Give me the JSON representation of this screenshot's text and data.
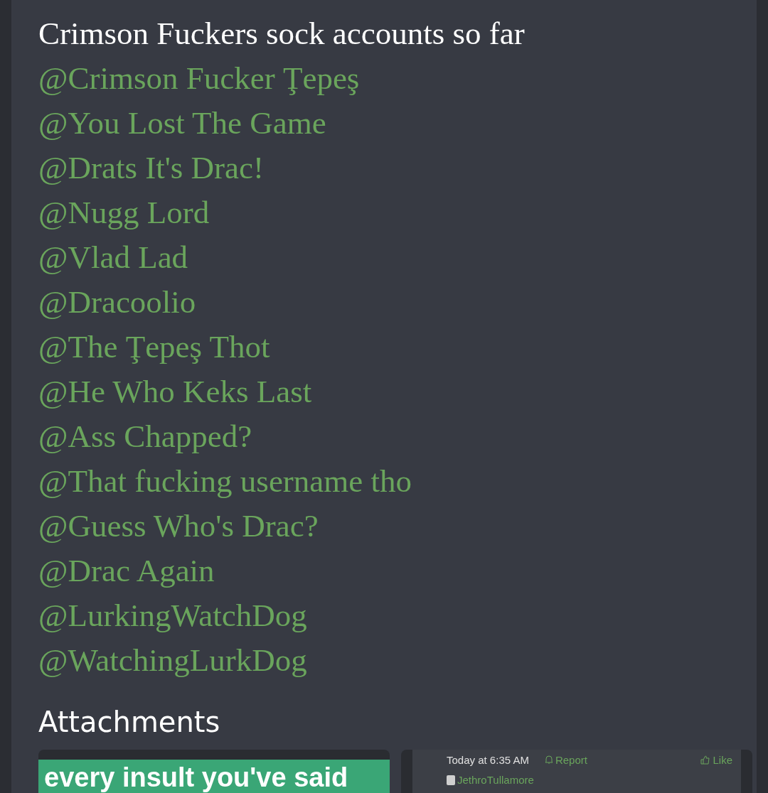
{
  "post": {
    "intro": "Crimson Fuckers sock accounts so far",
    "mentions": [
      "@Crimson Fucker Ţepeş",
      "@You Lost The Game",
      "@Drats It's Drac!",
      "@Nugg Lord",
      "@Vlad Lad",
      "@Dracoolio",
      "@The Ţepeş Thot",
      "@He Who Keks Last",
      "@Ass Chapped?",
      "@That fucking username tho",
      "@Guess Who's Drac?",
      "@Drac Again",
      "@LurkingWatchDog",
      "@WatchingLurkDog"
    ]
  },
  "attachments": {
    "title": "Attachments",
    "items": [
      {
        "kind": "caption",
        "text": "every insult you've said"
      },
      {
        "kind": "post",
        "time": "Today at 6:35 AM",
        "report": "Report",
        "like": "Like",
        "user": "JethroTullamore"
      }
    ]
  }
}
